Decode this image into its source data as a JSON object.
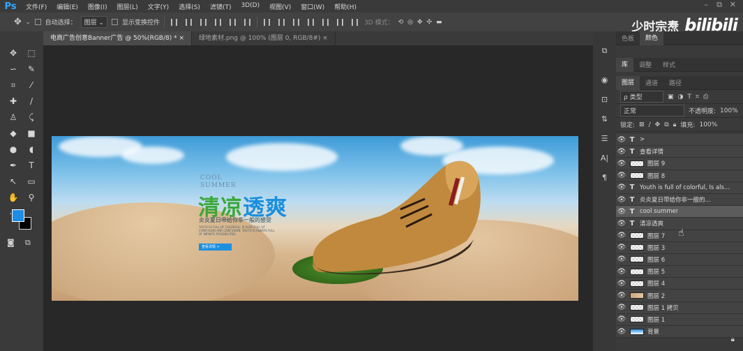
{
  "app": {
    "logo": "Ps"
  },
  "menu": [
    "文件(F)",
    "编辑(E)",
    "图像(I)",
    "图层(L)",
    "文字(Y)",
    "选择(S)",
    "滤镜(T)",
    "3D(D)",
    "视图(V)",
    "窗口(W)",
    "帮助(H)"
  ],
  "window_controls": {
    "minimize": "–",
    "restore": "⧉",
    "close": "✕"
  },
  "options": {
    "auto_select_label": "自动选择：",
    "auto_select_value": "图层",
    "show_transform_label": "显示变换控件",
    "mode_3d_label": "3D 模式："
  },
  "watermark": {
    "author": "少时宗焘",
    "platform": "bilibili"
  },
  "tabs": [
    {
      "label": "电商广告创意Banner广告 @ 50%(RGB/8) *"
    },
    {
      "label": "绿地素材.png @ 100% (图层 0, RGB/8#)"
    }
  ],
  "tab_close": "×",
  "banner": {
    "cool": "COOL",
    "summer": "SUMMER",
    "title_a": "清凉",
    "title_b": "透爽",
    "subtitle": "炎炎夏日带给你非一般的感觉",
    "english": "YOUTH IS FULL OF COLORFUL, IS ALSO FULL OF CONFUSION AND CONFUSION, YOUTH IS ALWAYS FULL OF INFINITE POSSIBILITIES",
    "button": "查看详情   >"
  },
  "panels": {
    "row1": [
      {
        "label": "色板"
      },
      {
        "label": "颜色"
      }
    ],
    "row2": [
      {
        "label": "库"
      },
      {
        "label": "调整"
      },
      {
        "label": "样式"
      }
    ],
    "row3": [
      {
        "label": "图层"
      },
      {
        "label": "通道"
      },
      {
        "label": "路径"
      }
    ]
  },
  "layers_panel": {
    "filter_label": "ρ 类型",
    "blend_mode": "正常",
    "opacity_label": "不透明度:",
    "opacity_value": "100%",
    "lock_label": "锁定:",
    "fill_label": "填充:",
    "fill_value": "100%"
  },
  "layers": [
    {
      "type": "text",
      "name": ">"
    },
    {
      "type": "text",
      "name": "查看详情"
    },
    {
      "type": "image",
      "name": "图层 9"
    },
    {
      "type": "image",
      "name": "图层 8"
    },
    {
      "type": "text",
      "name": "Youth is full of colorful, Is als..."
    },
    {
      "type": "text",
      "name": "炎炎夏日带给你非一般的..."
    },
    {
      "type": "text",
      "name": "cool summer"
    },
    {
      "type": "text",
      "name": "清凉透爽"
    },
    {
      "type": "image",
      "name": "图层 7"
    },
    {
      "type": "image",
      "name": "图层 3"
    },
    {
      "type": "image",
      "name": "图层 6"
    },
    {
      "type": "image",
      "name": "图层 5"
    },
    {
      "type": "image",
      "name": "图层 4"
    },
    {
      "type": "image",
      "name": "图层 2",
      "thumb": "sand"
    },
    {
      "type": "image",
      "name": "图层 1 拷贝"
    },
    {
      "type": "image",
      "name": "图层 1"
    },
    {
      "type": "image",
      "name": "背景",
      "thumb": "sky"
    }
  ],
  "colors": {
    "accent": "#31a8ff",
    "title_green": "#3aa83b",
    "title_blue": "#1a8fde",
    "foreground": "#1e8de6",
    "background": "#000000"
  }
}
